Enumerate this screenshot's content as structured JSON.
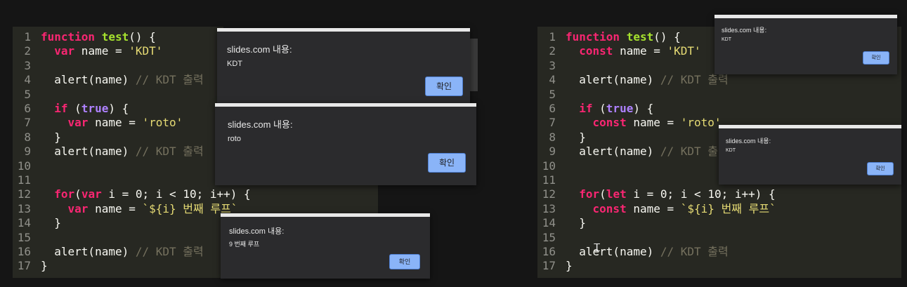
{
  "left_code": [
    {
      "n": "1",
      "toks": [
        [
          "k",
          "function"
        ],
        [
          "p",
          " "
        ],
        [
          "f",
          "test"
        ],
        [
          "p",
          "() {"
        ]
      ]
    },
    {
      "n": "2",
      "toks": [
        [
          "p",
          "  "
        ],
        [
          "k",
          "var"
        ],
        [
          "p",
          " name = "
        ],
        [
          "s",
          "'KDT'"
        ]
      ]
    },
    {
      "n": "3",
      "toks": []
    },
    {
      "n": "4",
      "toks": [
        [
          "p",
          "  alert(name) "
        ],
        [
          "c",
          "// KDT 출력"
        ]
      ]
    },
    {
      "n": "5",
      "toks": []
    },
    {
      "n": "6",
      "toks": [
        [
          "p",
          "  "
        ],
        [
          "k",
          "if"
        ],
        [
          "p",
          " ("
        ],
        [
          "n",
          "true"
        ],
        [
          "p",
          ") {"
        ]
      ]
    },
    {
      "n": "7",
      "toks": [
        [
          "p",
          "    "
        ],
        [
          "k",
          "var"
        ],
        [
          "p",
          " name = "
        ],
        [
          "s",
          "'roto'"
        ]
      ]
    },
    {
      "n": "8",
      "toks": [
        [
          "p",
          "  }"
        ]
      ]
    },
    {
      "n": "9",
      "toks": [
        [
          "p",
          "  alert(name) "
        ],
        [
          "c",
          "// KDT 출력"
        ]
      ]
    },
    {
      "n": "10",
      "toks": []
    },
    {
      "n": "11",
      "toks": []
    },
    {
      "n": "12",
      "toks": [
        [
          "p",
          "  "
        ],
        [
          "k",
          "for"
        ],
        [
          "p",
          "("
        ],
        [
          "k",
          "var"
        ],
        [
          "p",
          " i = 0; i < 10; i++) {"
        ]
      ]
    },
    {
      "n": "13",
      "toks": [
        [
          "p",
          "    "
        ],
        [
          "k",
          "var"
        ],
        [
          "p",
          " name = "
        ],
        [
          "s",
          "`${i} 번째 루프`"
        ]
      ]
    },
    {
      "n": "14",
      "toks": [
        [
          "p",
          "  }"
        ]
      ]
    },
    {
      "n": "15",
      "toks": []
    },
    {
      "n": "16",
      "toks": [
        [
          "p",
          "  alert(name) "
        ],
        [
          "c",
          "// KDT 출력"
        ]
      ]
    },
    {
      "n": "17",
      "toks": [
        [
          "p",
          "}"
        ]
      ]
    }
  ],
  "right_code": [
    {
      "n": "1",
      "toks": [
        [
          "k",
          "function"
        ],
        [
          "p",
          " "
        ],
        [
          "f",
          "test"
        ],
        [
          "p",
          "() {"
        ]
      ]
    },
    {
      "n": "2",
      "toks": [
        [
          "p",
          "  "
        ],
        [
          "k",
          "const"
        ],
        [
          "p",
          " name = "
        ],
        [
          "s",
          "'KDT'"
        ]
      ]
    },
    {
      "n": "3",
      "toks": []
    },
    {
      "n": "4",
      "toks": [
        [
          "p",
          "  alert(name) "
        ],
        [
          "c",
          "// KDT 출력"
        ]
      ]
    },
    {
      "n": "5",
      "toks": []
    },
    {
      "n": "6",
      "toks": [
        [
          "p",
          "  "
        ],
        [
          "k",
          "if"
        ],
        [
          "p",
          " ("
        ],
        [
          "n",
          "true"
        ],
        [
          "p",
          ") {"
        ]
      ]
    },
    {
      "n": "7",
      "toks": [
        [
          "p",
          "    "
        ],
        [
          "k",
          "const"
        ],
        [
          "p",
          " name = "
        ],
        [
          "s",
          "'roto'"
        ]
      ]
    },
    {
      "n": "8",
      "toks": [
        [
          "p",
          "  }"
        ]
      ]
    },
    {
      "n": "9",
      "toks": [
        [
          "p",
          "  alert(name) "
        ],
        [
          "c",
          "// KDT 출력"
        ]
      ]
    },
    {
      "n": "10",
      "toks": []
    },
    {
      "n": "11",
      "toks": []
    },
    {
      "n": "12",
      "toks": [
        [
          "p",
          "  "
        ],
        [
          "k",
          "for"
        ],
        [
          "p",
          "("
        ],
        [
          "k",
          "let"
        ],
        [
          "p",
          " i = 0; i < 10; i++) {"
        ]
      ]
    },
    {
      "n": "13",
      "toks": [
        [
          "p",
          "    "
        ],
        [
          "k",
          "const"
        ],
        [
          "p",
          " name = "
        ],
        [
          "s",
          "`${i} 번째 루프`"
        ]
      ]
    },
    {
      "n": "14",
      "toks": [
        [
          "p",
          "  }"
        ]
      ]
    },
    {
      "n": "15",
      "toks": []
    },
    {
      "n": "16",
      "toks": [
        [
          "p",
          "  alert(name) "
        ],
        [
          "c",
          "// KDT 출력"
        ]
      ]
    },
    {
      "n": "17",
      "toks": [
        [
          "p",
          "}"
        ]
      ]
    }
  ],
  "dialogs": {
    "d1": {
      "title": "slides.com 내용:",
      "message": "KDT",
      "ok": "확인"
    },
    "d2": {
      "title": "slides.com 내용:",
      "message": "roto",
      "ok": "확인"
    },
    "d3": {
      "title": "slides.com 내용:",
      "message": "9 번째 루프",
      "ok": "확인"
    },
    "d4": {
      "title": "slides.com 내용:",
      "message": "KDT",
      "ok": "확인"
    },
    "d5": {
      "title": "slides.com 내용:",
      "message": "KDT",
      "ok": "확인"
    }
  },
  "colors": {
    "editor_bg": "#272822",
    "keyword": "#f92672",
    "function": "#a6e22e",
    "string": "#e6db74",
    "comment": "#75715e",
    "boolean": "#ae81ff",
    "dialog_bg": "#2b2b2d",
    "ok_button": "#8ab4f8"
  },
  "icons": {
    "cursor": "text-cursor-icon"
  }
}
